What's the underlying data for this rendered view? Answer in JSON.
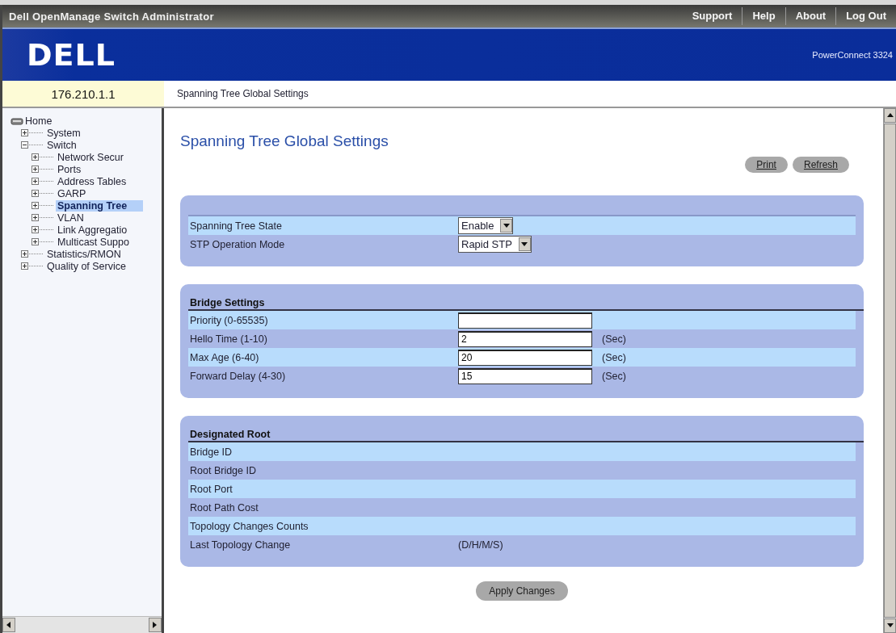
{
  "title_bar": {
    "title": "Dell OpenManage Switch Administrator",
    "links": [
      "Support",
      "Help",
      "About",
      "Log Out"
    ]
  },
  "header": {
    "logo": "DELL",
    "product": "PowerConnect 3324"
  },
  "address": "176.210.1.1",
  "breadcrumb": "Spanning Tree Global Settings",
  "tree": [
    {
      "label": "Home",
      "selected": false,
      "children": [
        {
          "label": "System",
          "expanded": false,
          "selected": false
        },
        {
          "label": "Switch",
          "expanded": true,
          "selected": false,
          "children": [
            {
              "label": "Network Secur",
              "expanded": false,
              "selected": false
            },
            {
              "label": "Ports",
              "expanded": false,
              "selected": false
            },
            {
              "label": "Address Tables",
              "expanded": false,
              "selected": false
            },
            {
              "label": "GARP",
              "expanded": false,
              "selected": false
            },
            {
              "label": "Spanning Tree",
              "expanded": false,
              "selected": true
            },
            {
              "label": "VLAN",
              "expanded": false,
              "selected": false
            },
            {
              "label": "Link Aggregatio",
              "expanded": false,
              "selected": false
            },
            {
              "label": "Multicast Suppo",
              "expanded": false,
              "selected": false
            }
          ]
        },
        {
          "label": "Statistics/RMON",
          "expanded": false,
          "selected": false
        },
        {
          "label": "Quality of Service",
          "expanded": false,
          "selected": false
        }
      ]
    }
  ],
  "page_title": "Spanning Tree Global Settings",
  "actions": [
    "Print",
    "Refresh"
  ],
  "panels": [
    {
      "rows": [
        {
          "kind": "select",
          "label": "Spanning Tree State",
          "value": "Enable"
        },
        {
          "kind": "select",
          "label": "STP Operation Mode",
          "value": "Rapid STP"
        }
      ]
    },
    {
      "heading": "Bridge Settings",
      "rows": [
        {
          "kind": "input",
          "label": "Priority (0-65535)"
        },
        {
          "kind": "input",
          "label": "Hello Time (1-10)",
          "value": "2",
          "unit": "(Sec)"
        },
        {
          "kind": "input",
          "label": "Max Age (6-40)",
          "value": "20",
          "unit": "(Sec)"
        },
        {
          "kind": "input",
          "label": "Forward Delay (4-30)",
          "value": "15",
          "unit": "(Sec)"
        }
      ]
    },
    {
      "heading": "Designated Root",
      "rows": [
        {
          "kind": "info",
          "label": "Bridge ID"
        },
        {
          "kind": "info",
          "label": "Root Bridge ID"
        },
        {
          "kind": "info",
          "label": "Root Port"
        },
        {
          "kind": "info",
          "label": "Root Path Cost"
        },
        {
          "kind": "info",
          "label": "Topology Changes Counts"
        },
        {
          "kind": "info",
          "label": "Last Topology Change",
          "unit": "(D/H/M/S)"
        }
      ]
    }
  ],
  "apply_button": "Apply Changes"
}
